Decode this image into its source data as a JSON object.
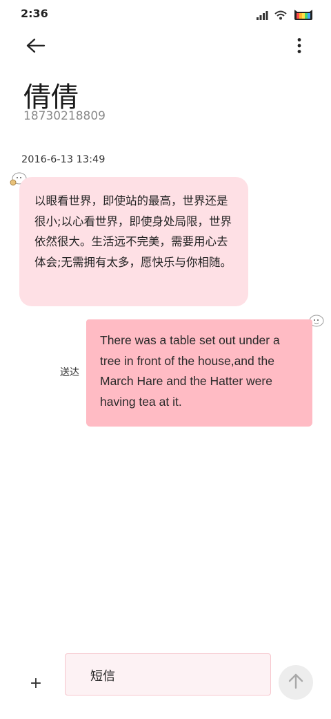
{
  "status_bar": {
    "time": "2:36",
    "icons": [
      "signal-icon",
      "wifi-icon",
      "battery-icon"
    ]
  },
  "header": {
    "back_icon": "arrow-left-icon",
    "more_icon": "more-vertical-icon",
    "contact_name": "倩倩",
    "contact_number": "18730218809"
  },
  "conversation": {
    "timestamp": "2016-6-13 13:49",
    "incoming": {
      "text": "以眼看世界，即使站的最高，世界还是很小;以心看世界，即使身处局限，世界依然很大。生活远不完美，需要用心去体会;无需拥有太多，愿快乐与你相随。"
    },
    "outgoing": {
      "text": "There was a table set out under a tree in front of the house,and the March Hare and the Hatter were having tea at it.",
      "status": "送达"
    }
  },
  "composer": {
    "add_label": "+",
    "placeholder": "短信",
    "send_icon": "arrow-up-icon"
  },
  "colors": {
    "incoming_bubble": "#fee0e5",
    "outgoing_bubble": "#ffbbc4",
    "input_border": "#f6c6cd",
    "send_button": "#ededed"
  }
}
